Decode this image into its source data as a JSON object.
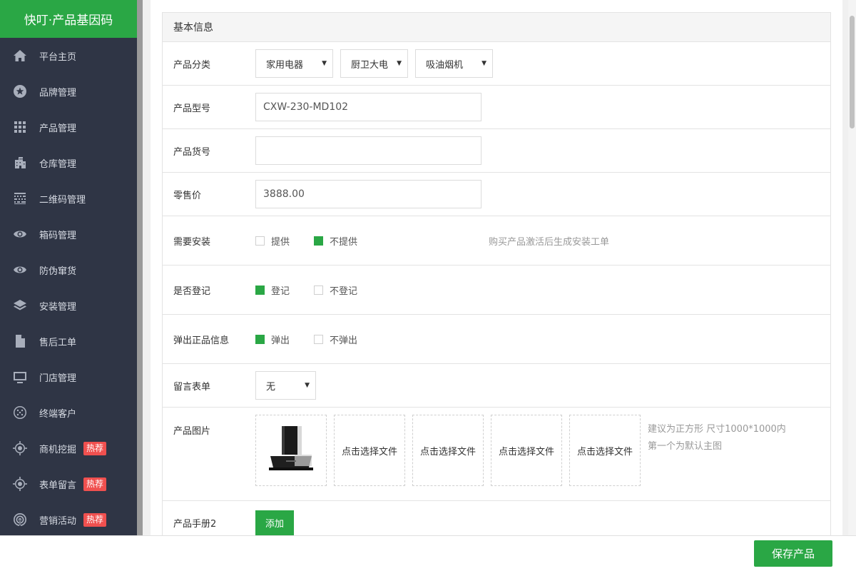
{
  "brand": {
    "title": "快叮·产品基因码"
  },
  "sidebar": {
    "items": [
      {
        "label": "平台主页",
        "icon": "home-icon"
      },
      {
        "label": "品牌管理",
        "icon": "star-icon"
      },
      {
        "label": "产品管理",
        "icon": "grid-icon"
      },
      {
        "label": "仓库管理",
        "icon": "building-icon"
      },
      {
        "label": "二维码管理",
        "icon": "qrcode-icon"
      },
      {
        "label": "箱码管理",
        "icon": "eye-icon"
      },
      {
        "label": "防伪窜货",
        "icon": "eye-icon"
      },
      {
        "label": "安装管理",
        "icon": "layers-icon"
      },
      {
        "label": "售后工单",
        "icon": "file-icon"
      },
      {
        "label": "门店管理",
        "icon": "monitor-icon"
      },
      {
        "label": "终端客户",
        "icon": "globe-icon"
      },
      {
        "label": "商机挖掘",
        "icon": "target-icon",
        "badge": "热荐"
      },
      {
        "label": "表单留言",
        "icon": "target-icon",
        "badge": "热荐"
      },
      {
        "label": "营销活动",
        "icon": "broadcast-icon",
        "badge": "热荐"
      }
    ]
  },
  "form": {
    "section_title": "基本信息",
    "category": {
      "label": "产品分类",
      "selects": [
        "家用电器",
        "厨卫大电",
        "吸油烟机"
      ]
    },
    "model": {
      "label": "产品型号",
      "value": "CXW-230-MD102"
    },
    "sku": {
      "label": "产品货号",
      "value": ""
    },
    "price": {
      "label": "零售价",
      "value": "3888.00"
    },
    "install": {
      "label": "需要安装",
      "options": [
        {
          "label": "提供",
          "checked": false
        },
        {
          "label": "不提供",
          "checked": true
        }
      ],
      "hint": "购买产品激活后生成安装工单"
    },
    "register": {
      "label": "是否登记",
      "options": [
        {
          "label": "登记",
          "checked": true
        },
        {
          "label": "不登记",
          "checked": false
        }
      ]
    },
    "popup": {
      "label": "弹出正品信息",
      "options": [
        {
          "label": "弹出",
          "checked": true
        },
        {
          "label": "不弹出",
          "checked": false
        }
      ]
    },
    "message_form": {
      "label": "留言表单",
      "value": "无"
    },
    "images": {
      "label": "产品图片",
      "slot_text": "点击选择文件",
      "hint_line1": "建议为正方形 尺寸1000*1000内",
      "hint_line2": "第一个为默认主图"
    },
    "manual": {
      "label": "产品手册2",
      "button": "添加"
    }
  },
  "footer": {
    "save_label": "保存产品"
  },
  "colors": {
    "accent": "#2aa745",
    "sidebar_bg": "#2f3545",
    "badge": "#f0504f"
  }
}
